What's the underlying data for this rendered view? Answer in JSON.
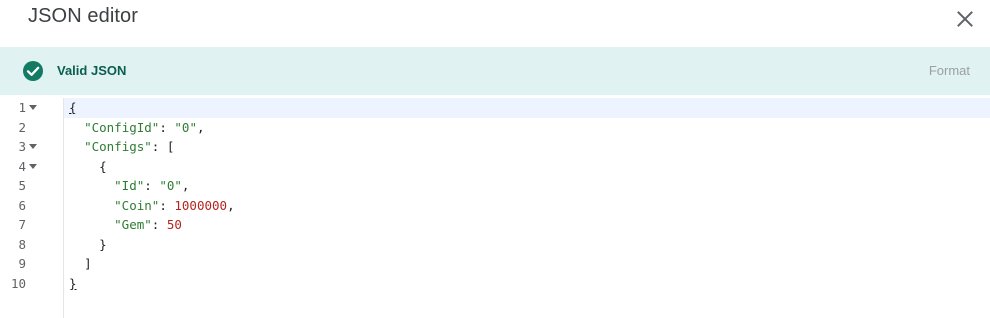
{
  "dialog": {
    "title": "JSON editor",
    "close_icon": "close-icon"
  },
  "status": {
    "icon": "check-circle-icon",
    "text": "Valid JSON",
    "format_label": "Format",
    "colors": {
      "background": "#e0f2f1",
      "icon": "#137a63",
      "text": "#0b5e4f"
    }
  },
  "editor": {
    "active_line": 1,
    "fold_icon": "fold-caret-icon",
    "lines": [
      {
        "number": "1",
        "foldable": true
      },
      {
        "number": "2",
        "foldable": false
      },
      {
        "number": "3",
        "foldable": true
      },
      {
        "number": "4",
        "foldable": true
      },
      {
        "number": "5",
        "foldable": false
      },
      {
        "number": "6",
        "foldable": false
      },
      {
        "number": "7",
        "foldable": false
      },
      {
        "number": "8",
        "foldable": false
      },
      {
        "number": "9",
        "foldable": false
      },
      {
        "number": "10",
        "foldable": false
      }
    ],
    "code": {
      "l1_open": "{",
      "l2_key": "\"ConfigId\"",
      "l2_sep": ": ",
      "l2_val": "\"0\"",
      "l2_end": ",",
      "l3_key": "\"Configs\"",
      "l3_sep": ": [",
      "l4_open": "{",
      "l5_key": "\"Id\"",
      "l5_sep": ": ",
      "l5_val": "\"0\"",
      "l5_end": ",",
      "l6_key": "\"Coin\"",
      "l6_sep": ": ",
      "l6_val": "1000000",
      "l6_end": ",",
      "l7_key": "\"Gem\"",
      "l7_sep": ": ",
      "l7_val": "50",
      "l8_close": "}",
      "l9_close": "]",
      "l10_close": "}"
    },
    "colors": {
      "key": "#2e7d32",
      "string": "#2e7d32",
      "number": "#b3261e",
      "active_line_bg": "#eef4ff"
    }
  }
}
